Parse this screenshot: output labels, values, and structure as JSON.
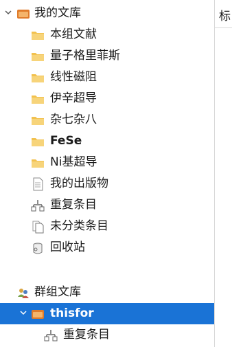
{
  "my_library": {
    "label": "我的文库",
    "items": [
      {
        "label": "本组文献",
        "icon": "folder-icon"
      },
      {
        "label": "量子格里菲斯",
        "icon": "folder-icon"
      },
      {
        "label": "线性磁阻",
        "icon": "folder-icon"
      },
      {
        "label": "伊辛超导",
        "icon": "folder-icon"
      },
      {
        "label": "杂七杂八",
        "icon": "folder-icon"
      },
      {
        "label": "FeSe",
        "icon": "folder-icon"
      },
      {
        "label": "Ni基超导",
        "icon": "folder-icon"
      },
      {
        "label": "我的出版物",
        "icon": "document-icon"
      },
      {
        "label": "重复条目",
        "icon": "duplicate-icon"
      },
      {
        "label": "未分类条目",
        "icon": "unfiled-icon"
      },
      {
        "label": "回收站",
        "icon": "trash-icon"
      }
    ]
  },
  "group_library": {
    "label": "群组文库",
    "group": {
      "label": "thisfor",
      "children": [
        {
          "label": "重复条目",
          "icon": "duplicate-icon"
        }
      ]
    }
  },
  "right_pane": {
    "column_header": "标"
  },
  "colors": {
    "folder": "#f2c14e",
    "selected": "#1a73d6"
  }
}
